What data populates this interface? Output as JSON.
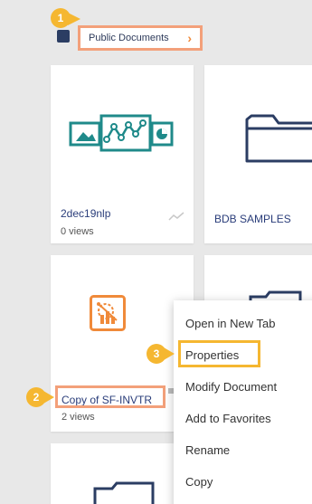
{
  "header": {
    "breadcrumb_label": "Public Documents",
    "breadcrumb_chevron": "›"
  },
  "tiles": [
    {
      "title": "2dec19nlp",
      "views": "0 views",
      "icon": "chart-dashboard-icon"
    },
    {
      "title": "BDB SAMPLES",
      "icon": "folder-icon"
    },
    {
      "title": "Copy of SF-INVTR",
      "views": "2 views",
      "icon": "report-icon"
    }
  ],
  "context_menu": {
    "items": [
      "Open in New Tab",
      "Properties",
      "Modify Document",
      "Add to Favorites",
      "Rename",
      "Copy"
    ]
  },
  "callouts": [
    "1",
    "2",
    "3"
  ],
  "colors": {
    "badge": "#f5b731",
    "highlight_orange": "#f3a07a",
    "icon_teal": "#1f8a8a",
    "icon_orange": "#f08a3a",
    "navy": "#2b3d63"
  }
}
